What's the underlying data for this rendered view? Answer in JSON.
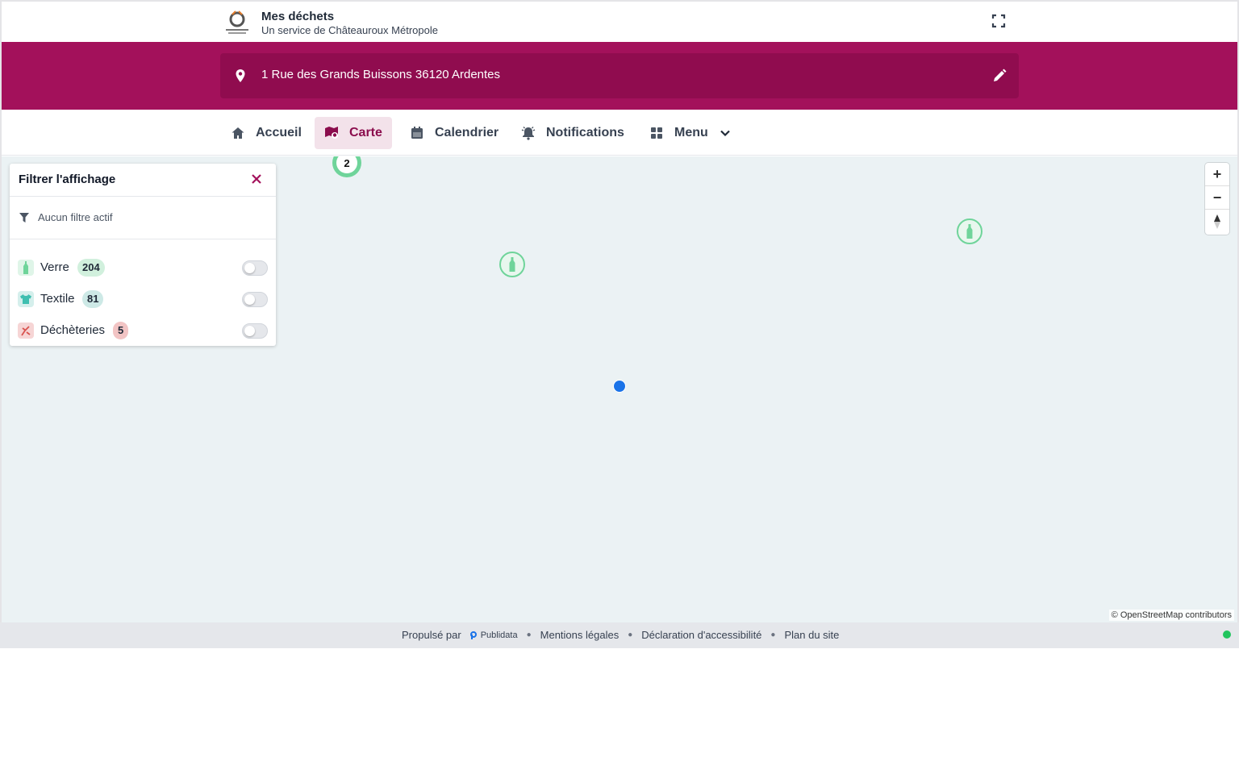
{
  "header": {
    "title": "Mes déchets",
    "subtitle": "Un service de Châteauroux Métropole"
  },
  "address": {
    "text": "1 Rue des Grands Buissons 36120 Ardentes"
  },
  "nav": {
    "items": [
      {
        "label": "Accueil",
        "icon": "home-icon"
      },
      {
        "label": "Carte",
        "icon": "map-icon",
        "active": true
      },
      {
        "label": "Calendrier",
        "icon": "calendar-icon"
      },
      {
        "label": "Notifications",
        "icon": "bell-icon"
      },
      {
        "label": "Menu",
        "icon": "grid-icon"
      }
    ]
  },
  "filter": {
    "title": "Filtrer l'affichage",
    "status": "Aucun filtre actif",
    "categories": [
      {
        "label": "Verre",
        "count": "204",
        "color": "#6fd49a",
        "enabled": false
      },
      {
        "label": "Textile",
        "count": "81",
        "color": "#3fbfb0",
        "enabled": false
      },
      {
        "label": "Déchèteries",
        "count": "5",
        "color": "#e06a6a",
        "enabled": false
      }
    ]
  },
  "map": {
    "cluster_count": "2",
    "attribution": "© OpenStreetMap contributors",
    "zoom_in": "+",
    "zoom_out": "−"
  },
  "footer": {
    "powered_by": "Propulsé par",
    "powered_brand": "Publidata",
    "links": [
      "Mentions légales",
      "Déclaration d'accessibilité",
      "Plan du site"
    ]
  },
  "colors": {
    "brand": "#a3115b",
    "brand_dark": "#900c4f",
    "glass": "#6fd49a",
    "user_location": "#1a73e8"
  }
}
